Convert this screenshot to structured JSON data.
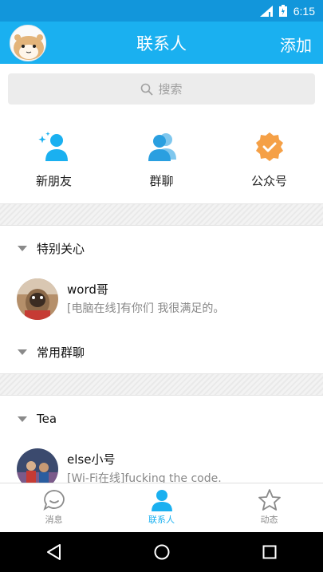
{
  "status_bar": {
    "time": "6:15"
  },
  "header": {
    "title": "联系人",
    "action_label": "添加"
  },
  "search": {
    "placeholder": "搜索"
  },
  "quick_actions": [
    {
      "label": "新朋友",
      "icon": "new-friend-icon"
    },
    {
      "label": "群聊",
      "icon": "group-chat-icon"
    },
    {
      "label": "公众号",
      "icon": "official-account-icon"
    }
  ],
  "groups": [
    {
      "title": "特别关心",
      "contacts": [
        {
          "name": "word哥",
          "status": "[电脑在线]有你们 我很满足的。"
        }
      ]
    },
    {
      "title": "常用群聊",
      "contacts": []
    },
    {
      "title": "Tea",
      "contacts": [
        {
          "name": "else小号",
          "status": "[Wi-Fi在线]fucking the code."
        }
      ]
    }
  ],
  "tabs": [
    {
      "label": "消息",
      "icon": "message-icon",
      "active": false
    },
    {
      "label": "联系人",
      "icon": "contacts-icon",
      "active": true
    },
    {
      "label": "动态",
      "icon": "star-icon",
      "active": false
    }
  ],
  "colors": {
    "accent": "#1ab0f0",
    "status_bar": "#1296db",
    "official_badge": "#f5a046"
  }
}
